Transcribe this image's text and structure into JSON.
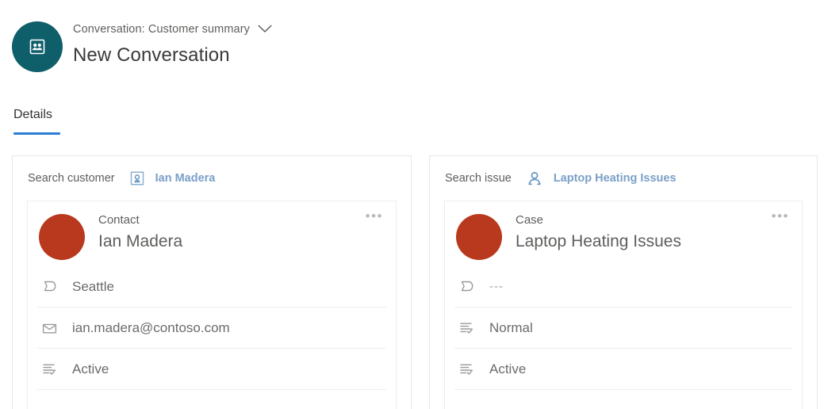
{
  "header": {
    "avatar_icon": "conversation-avatar-icon",
    "subtitle": "Conversation: Customer summary",
    "chevron_icon": "chevron-down-icon",
    "title": "New Conversation",
    "avatar_color": "#0f5f6b"
  },
  "tabs": [
    {
      "label": "Details",
      "active": true
    }
  ],
  "cards": [
    {
      "search_label": "Search customer",
      "search_icon": "contact-card-icon",
      "search_value": "Ian Madera",
      "entity": {
        "type": "Contact",
        "name": "Ian Madera",
        "avatar_color": "#b8391d",
        "overflow_label": "•••"
      },
      "rows": [
        {
          "icon": "location-flag-icon",
          "value": "Seattle",
          "dim": false
        },
        {
          "icon": "email-icon",
          "value": "ian.madera@contoso.com",
          "dim": false
        },
        {
          "icon": "status-list-icon",
          "value": "Active",
          "dim": false
        }
      ]
    },
    {
      "search_label": "Search issue",
      "search_icon": "person-icon",
      "search_value": "Laptop Heating Issues",
      "entity": {
        "type": "Case",
        "name": "Laptop Heating Issues",
        "avatar_color": "#b8391d",
        "overflow_label": "•••"
      },
      "rows": [
        {
          "icon": "location-flag-icon",
          "value": "---",
          "dim": true
        },
        {
          "icon": "status-list-icon",
          "value": "Normal",
          "dim": false
        },
        {
          "icon": "status-list-icon",
          "value": "Active",
          "dim": false
        }
      ]
    }
  ],
  "colors": {
    "accent_blue": "#2b7cd3",
    "link_blue": "#7ba0c8",
    "teal": "#0f5f6b",
    "avatar_red": "#b8391d",
    "text_gray": "#605e5c"
  }
}
